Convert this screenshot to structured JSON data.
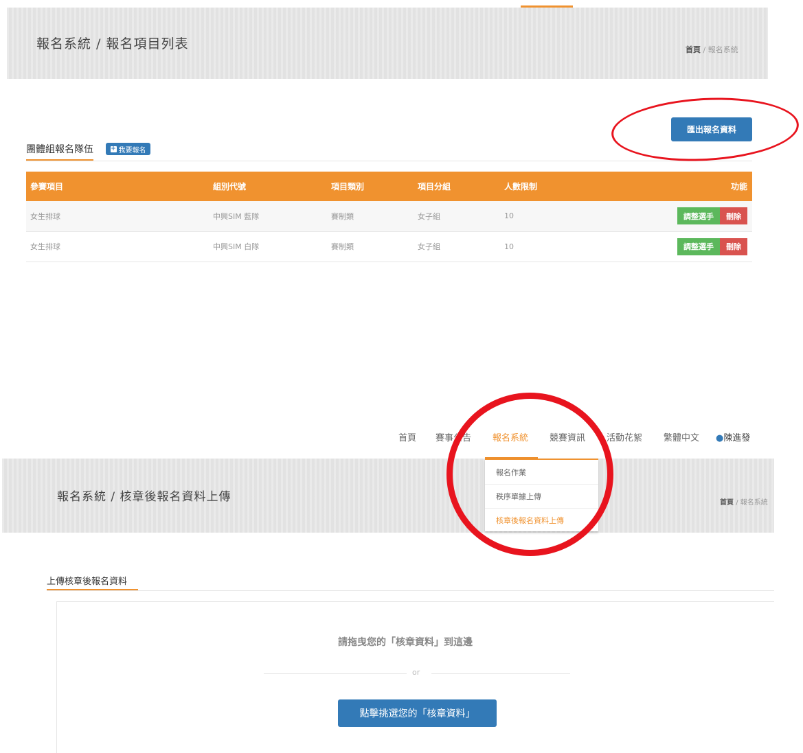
{
  "top_page": {
    "header": {
      "title": "報名系統 / 報名項目列表",
      "breadcrumb_home": "首頁",
      "breadcrumb_sep": "/",
      "breadcrumb_current": "報名系統"
    },
    "export_button": "匯出報名資料",
    "section_title": "團體組報名隊伍",
    "signup_button": "我要報名",
    "table": {
      "columns": [
        "參賽項目",
        "組別代號",
        "項目類別",
        "項目分組",
        "人數限制",
        "功能"
      ],
      "rows": [
        [
          "女生排球",
          "中興SIM 藍隊",
          "賽制類",
          "女子組",
          "10"
        ],
        [
          "女生排球",
          "中興SIM 白隊",
          "賽制類",
          "女子組",
          "10"
        ]
      ],
      "adjust_label": "調整選手",
      "delete_label": "刪除"
    }
  },
  "bottom_page": {
    "nav": {
      "items": [
        "首頁",
        "賽事公告",
        "報名系統",
        "競賽資訊",
        "活動花絮",
        "繁體中文"
      ],
      "active_index": 2,
      "user": "陳進發"
    },
    "dropdown": {
      "items": [
        "報名作業",
        "秩序單據上傳",
        "核章後報名資料上傳"
      ],
      "active_index": 2
    },
    "header": {
      "title": "報名系統 / 核章後報名資料上傳",
      "breadcrumb_home": "首頁",
      "breadcrumb_sep": "/",
      "breadcrumb_current": "報名系統"
    },
    "section_title": "上傳核章後報名資料",
    "dropzone": {
      "drag_text": "請拖曳您的「核章資料」到這邊",
      "or_text": "or",
      "select_button": "點擊挑選您的「核章資料」"
    }
  },
  "colors": {
    "accent": "#f0922f",
    "primary": "#337ab7",
    "success": "#5cb85c",
    "danger": "#d9534f",
    "annotation": "#e8141e"
  }
}
